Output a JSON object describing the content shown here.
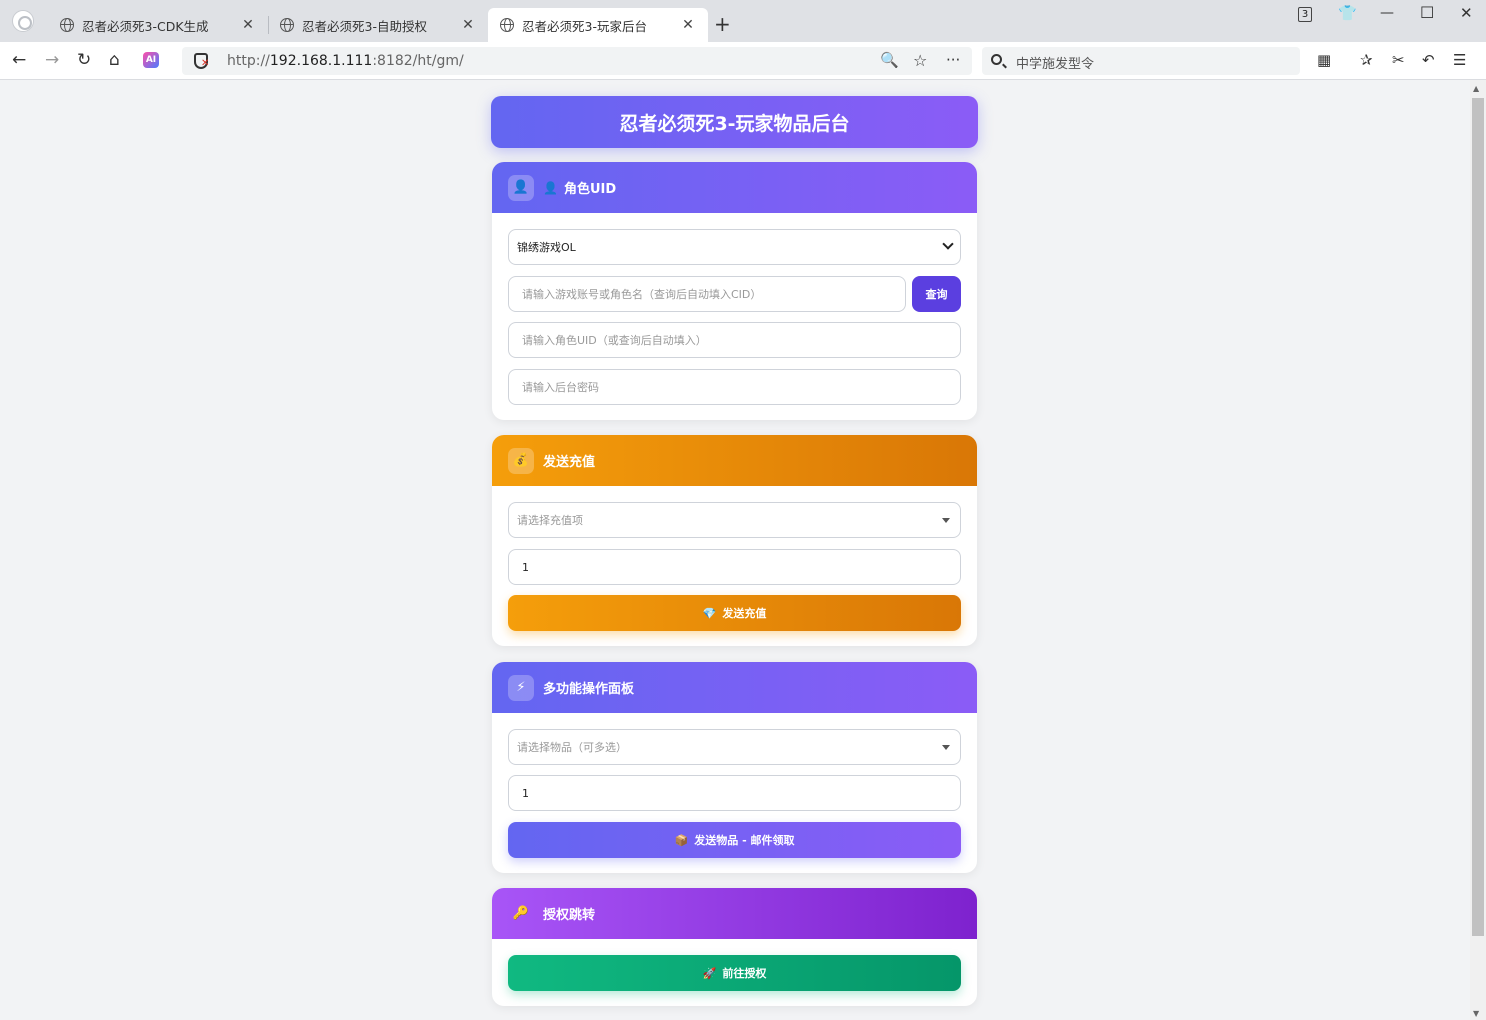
{
  "browser": {
    "tabs": [
      {
        "title": "忍者必须死3-CDK生成",
        "close": "✕"
      },
      {
        "title": "忍者必须死3-自助授权",
        "close": "✕"
      },
      {
        "title": "忍者必须死3-玩家后台",
        "close": "✕"
      }
    ],
    "new_tab": "+",
    "tab_count": "3",
    "url_prefix": "http://",
    "url_host": "192.168.1.111",
    "url_rest": ":8182/ht/gm/",
    "search_text": "中学施发型令",
    "ai_label": "AI"
  },
  "page": {
    "title": "忍者必须死3-玩家物品后台",
    "role_card": {
      "title": "角色UID",
      "badge_icon": "👤",
      "title_icon": "👤",
      "server_value": "锦绣游戏OL",
      "account_placeholder": "请输入游戏账号或角色名（查询后自动填入CID）",
      "query_button": "查询",
      "uid_placeholder": "请输入角色UID（或查询后自动填入）",
      "password_placeholder": "请输入后台密码"
    },
    "recharge_card": {
      "title": "发送充值",
      "badge_icon": "💰",
      "select_placeholder": "请选择充值项",
      "quantity": "1",
      "button_icon": "💎",
      "button_label": "发送充值"
    },
    "multi_card": {
      "title": "多功能操作面板",
      "badge_icon": "⚡",
      "select_placeholder": "请选择物品（可多选）",
      "quantity": "1",
      "button_icon": "📦",
      "button_label": "发送物品 - 邮件领取"
    },
    "auth_card": {
      "title": "授权跳转",
      "badge_icon": "🔑",
      "button_icon": "🚀",
      "button_label": "前往授权"
    }
  }
}
